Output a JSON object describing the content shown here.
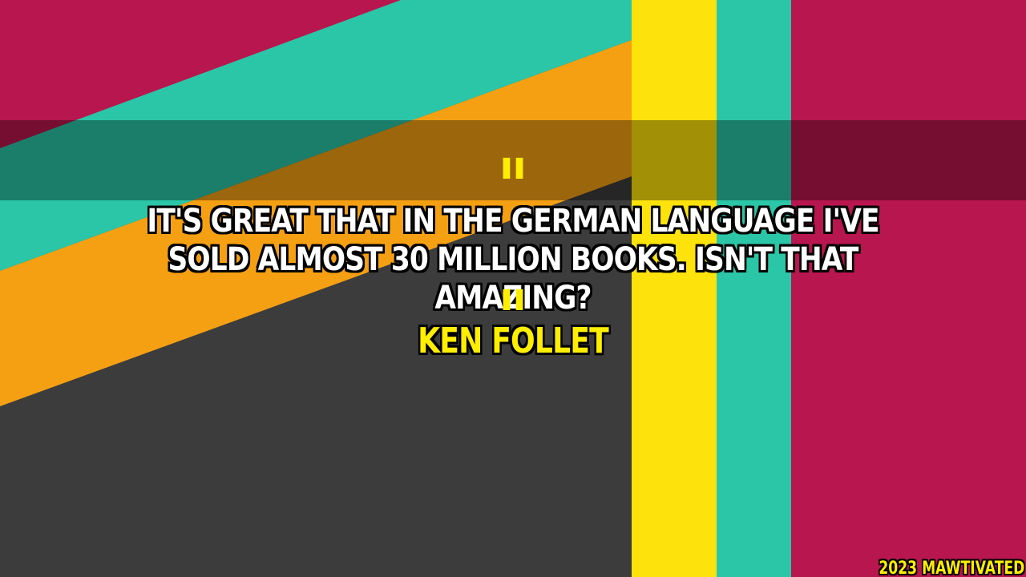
{
  "quote": {
    "open_mark": "\"",
    "text": "IT'S GREAT THAT IN THE GERMAN LANGUAGE I'VE SOLD ALMOST 30 MILLION BOOKS. ISN'T THAT AMAZING?",
    "close_mark": "\""
  },
  "author": "KEN FOLLET",
  "watermark": "2023 MAWTIVATED",
  "colors": {
    "background_dark": "#3c3c3c",
    "crimson": "#b8164e",
    "teal": "#2bc6a7",
    "orange": "#f5a013",
    "yellow": "#fde20b",
    "quote_text": "#ffffff",
    "accent_text": "#ffee00"
  }
}
